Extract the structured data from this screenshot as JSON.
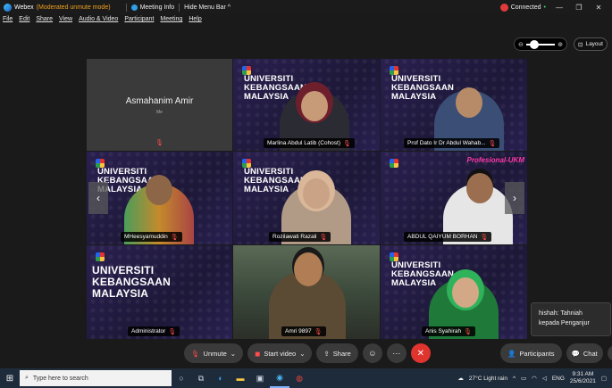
{
  "titlebar": {
    "app": "Webex",
    "mode": "(Moderated unmute mode)",
    "meeting_info": "Meeting Info",
    "hide_menu": "Hide Menu Bar ^",
    "status": "Connected",
    "status_dot": "•",
    "win_min": "—",
    "win_restore": "❐",
    "win_close": "✕"
  },
  "menu": [
    "File",
    "Edit",
    "Share",
    "View",
    "Audio & Video",
    "Participant",
    "Meeting",
    "Help"
  ],
  "zoom": {
    "minus": "⊖",
    "plus": "⊕"
  },
  "layout_label": "Layout",
  "ukm_text": "UNIVERSITI\nKEBANGSAAN\nMALAYSIA",
  "prof_banner": "Profesional-UKM",
  "tiles": [
    {
      "name": "Asmahanim Amir",
      "sub": "Me"
    },
    {
      "name": "Marlina Abdul Latib  (Cohost)"
    },
    {
      "name": "Prof Dato Ir Dr Abdul Wahab..."
    },
    {
      "name": "MHeesyamuddin"
    },
    {
      "name": "Rozilawati Razali"
    },
    {
      "name": "ABDUL QAIYUM BORHAN"
    },
    {
      "name": "Administrator"
    },
    {
      "name": "Amri 9897"
    },
    {
      "name": "Anis Syahirah"
    }
  ],
  "nav": {
    "prev": "‹",
    "next": "›"
  },
  "chat_popup": {
    "sender_line": "hishah: Tahniah",
    "message": "kepada Penganjur"
  },
  "controls": {
    "unmute": "Unmute",
    "start_video": "Start video",
    "share": "Share",
    "participants": "Participants",
    "chat": "Chat",
    "more": "···",
    "end": "✕"
  },
  "taskbar": {
    "search_placeholder": "Type here to search",
    "weather": "27°C  Light rain",
    "lang": "ENG",
    "time": "9:31 AM",
    "date": "25/6/2021"
  }
}
